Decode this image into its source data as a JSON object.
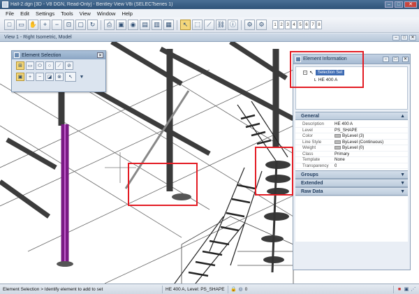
{
  "window": {
    "title": "Hall-2.dgn [3D - V8 DGN, Read-Only] - Bentley View V8i (SELECTseries 1)",
    "buttons": {
      "minimize": "–",
      "maximize": "□",
      "close": "✕"
    }
  },
  "menu": [
    "File",
    "Edit",
    "Settings",
    "Tools",
    "View",
    "Window",
    "Help"
  ],
  "toolbar": {
    "icons": [
      "new-icon",
      "open-icon",
      "hand-icon",
      "zoom-in-icon",
      "zoom-out-icon",
      "fit-icon",
      "window-area-icon",
      "rotate-icon",
      "print-icon",
      "save-icon",
      "reference-icon",
      "display-icon",
      "view-icon",
      "render-icon",
      "select-arrow-icon",
      "select-icon",
      "measure-icon",
      "link-icon",
      "info-icon",
      "settings-icon",
      "options-icon"
    ],
    "level_buttons": [
      "1",
      "2",
      "3",
      "4",
      "5",
      "6",
      "7",
      "8"
    ]
  },
  "view": {
    "title": "View 1 - Right Isometric, Model"
  },
  "element_selection": {
    "title": "Element Selection"
  },
  "element_info": {
    "title": "Element Information",
    "tree_root": "Selection Set",
    "tree_child": "HE 400 A",
    "sections": {
      "general": "General",
      "groups": "Groups",
      "extended": "Extended",
      "raw_data": "Raw Data"
    },
    "properties": [
      {
        "key": "Description",
        "value": "HE 400 A"
      },
      {
        "key": "Level",
        "value": "PS_SHAPE"
      },
      {
        "key": "Color",
        "value": "ByLevel (3)"
      },
      {
        "key": "Line Style",
        "value": "ByLevel (Continuous)"
      },
      {
        "key": "Weight",
        "value": "ByLevel (0)"
      },
      {
        "key": "Class",
        "value": "Primary"
      },
      {
        "key": "Template",
        "value": "None"
      },
      {
        "key": "Transparency",
        "value": "0"
      }
    ]
  },
  "status": {
    "message": "Element Selection > Identify element to add to set",
    "element": "HE 400 A, Level: PS_SHAPE",
    "count": "0"
  },
  "colors": {
    "highlight": "#e31b23",
    "selected_beam": "#7a1a84"
  }
}
